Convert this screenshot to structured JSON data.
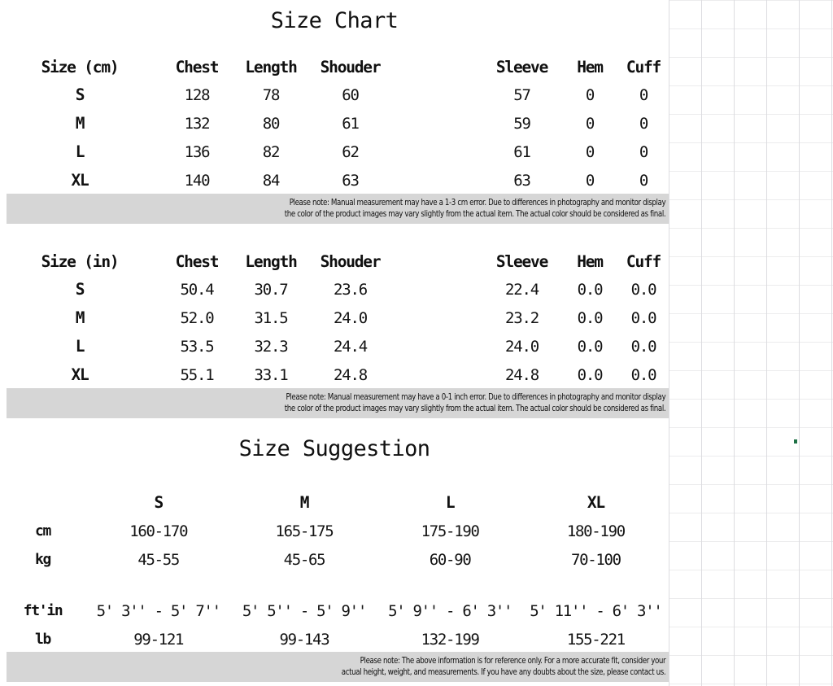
{
  "sections": {
    "size_chart_title": "Size Chart",
    "size_suggestion_title": "Size Suggestion"
  },
  "colors": {
    "note_bar_background": "#d6d6d6",
    "text": "#131313",
    "grid_line": "#e9e9ec",
    "cell_handle": "#1e7145"
  },
  "table_cm": {
    "headers": [
      "Size (cm)",
      "Chest",
      "Length",
      "Shouder",
      "",
      "Sleeve",
      "Hem",
      "Cuff"
    ],
    "rows": [
      {
        "size": "S",
        "chest": "128",
        "length": "78",
        "shoulder": "60",
        "gap": "",
        "sleeve": "57",
        "hem": "0",
        "cuff": "0"
      },
      {
        "size": "M",
        "chest": "132",
        "length": "80",
        "shoulder": "61",
        "gap": "",
        "sleeve": "59",
        "hem": "0",
        "cuff": "0"
      },
      {
        "size": "L",
        "chest": "136",
        "length": "82",
        "shoulder": "62",
        "gap": "",
        "sleeve": "61",
        "hem": "0",
        "cuff": "0"
      },
      {
        "size": "XL",
        "chest": "140",
        "length": "84",
        "shoulder": "63",
        "gap": "",
        "sleeve": "63",
        "hem": "0",
        "cuff": "0"
      }
    ],
    "note_line1": "Please note: Manual measurement may have a 1-3 cm error. Due to differences in photography and monitor display",
    "note_line2": "the color of the product images may vary slightly from the actual item. The actual color should be considered as final."
  },
  "table_in": {
    "headers": [
      "Size (in)",
      "Chest",
      "Length",
      "Shouder",
      "",
      "Sleeve",
      "Hem",
      "Cuff"
    ],
    "rows": [
      {
        "size": "S",
        "chest": "50.4",
        "length": "30.7",
        "shoulder": "23.6",
        "gap": "",
        "sleeve": "22.4",
        "hem": "0.0",
        "cuff": "0.0"
      },
      {
        "size": "M",
        "chest": "52.0",
        "length": "31.5",
        "shoulder": "24.0",
        "gap": "",
        "sleeve": "23.2",
        "hem": "0.0",
        "cuff": "0.0"
      },
      {
        "size": "L",
        "chest": "53.5",
        "length": "32.3",
        "shoulder": "24.4",
        "gap": "",
        "sleeve": "24.0",
        "hem": "0.0",
        "cuff": "0.0"
      },
      {
        "size": "XL",
        "chest": "55.1",
        "length": "33.1",
        "shoulder": "24.8",
        "gap": "",
        "sleeve": "24.8",
        "hem": "0.0",
        "cuff": "0.0"
      }
    ],
    "note_line1": "Please note: Manual measurement may have a 0-1 inch error. Due to differences in photography and monitor display",
    "note_line2": "the color of the product images may vary slightly from the actual item. The actual color should be considered as final."
  },
  "table_suggestion": {
    "headers": [
      "",
      "S",
      "M",
      "L",
      "XL"
    ],
    "rows": [
      {
        "label": "cm",
        "s": "160-170",
        "m": "165-175",
        "l": "175-190",
        "xl": "180-190"
      },
      {
        "label": "kg",
        "s": "45-55",
        "m": "45-65",
        "l": "60-90",
        "xl": "70-100"
      },
      {
        "label": "ft'in",
        "s": "5' 3'' - 5' 7''",
        "m": "5' 5'' - 5' 9''",
        "l": "5' 9'' - 6' 3''",
        "xl": "5' 11'' - 6' 3''"
      },
      {
        "label": "lb",
        "s": "99-121",
        "m": "99-143",
        "l": "132-199",
        "xl": "155-221"
      }
    ],
    "note_line1": "Please note: The above information is for reference only. For a more accurate fit, consider your",
    "note_line2": "actual height, weight, and measurements. If you have any doubts about the size, please contact us."
  }
}
